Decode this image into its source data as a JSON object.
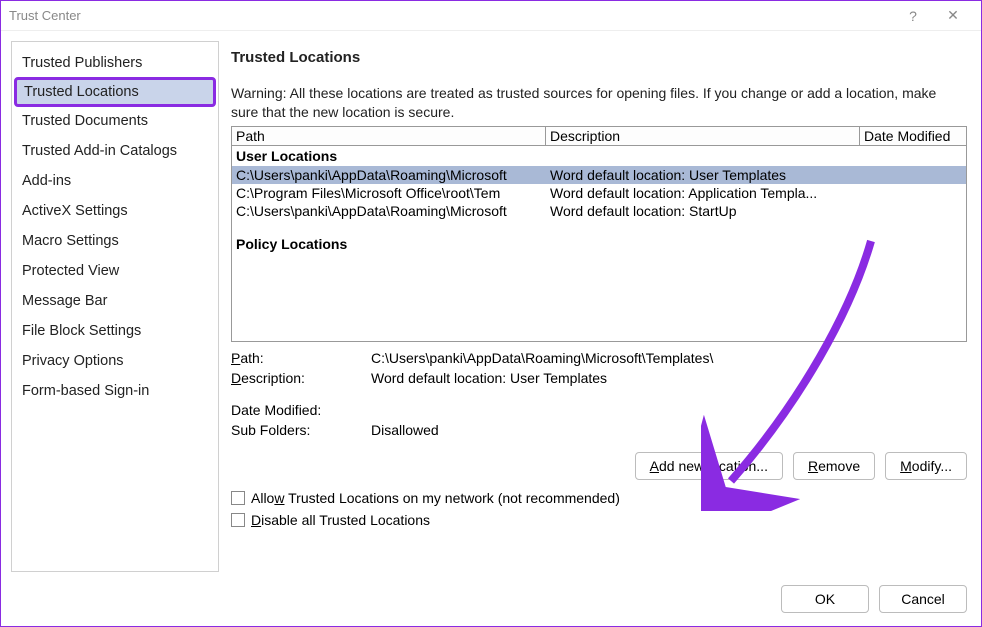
{
  "window": {
    "title": "Trust Center",
    "help_tooltip": "?",
    "close_tooltip": "✕"
  },
  "sidebar": {
    "items": [
      {
        "label": "Trusted Publishers",
        "selected": false
      },
      {
        "label": "Trusted Locations",
        "selected": true
      },
      {
        "label": "Trusted Documents",
        "selected": false
      },
      {
        "label": "Trusted Add-in Catalogs",
        "selected": false
      },
      {
        "label": "Add-ins",
        "selected": false
      },
      {
        "label": "ActiveX Settings",
        "selected": false
      },
      {
        "label": "Macro Settings",
        "selected": false
      },
      {
        "label": "Protected View",
        "selected": false
      },
      {
        "label": "Message Bar",
        "selected": false
      },
      {
        "label": "File Block Settings",
        "selected": false
      },
      {
        "label": "Privacy Options",
        "selected": false
      },
      {
        "label": "Form-based Sign-in",
        "selected": false
      }
    ]
  },
  "main": {
    "heading": "Trusted Locations",
    "warning": "Warning: All these locations are treated as trusted sources for opening files.  If you change or add a location, make sure that the new location is secure.",
    "columns": {
      "path": "Path",
      "desc": "Description",
      "date": "Date Modified"
    },
    "groups": {
      "user": "User Locations",
      "policy": "Policy Locations"
    },
    "rows": [
      {
        "path": "C:\\Users\\panki\\AppData\\Roaming\\Microsoft",
        "desc": "Word default location: User Templates",
        "date": "",
        "selected": true
      },
      {
        "path": "C:\\Program Files\\Microsoft Office\\root\\Tem",
        "desc": "Word default location: Application Templa...",
        "date": "",
        "selected": false
      },
      {
        "path": "C:\\Users\\panki\\AppData\\Roaming\\Microsoft",
        "desc": "Word default location: StartUp",
        "date": "",
        "selected": false
      }
    ],
    "details": {
      "path_label": "Path:",
      "path_value": "C:\\Users\\panki\\AppData\\Roaming\\Microsoft\\Templates\\",
      "desc_label": "Description:",
      "desc_value": "Word default location: User Templates",
      "date_label": "Date Modified:",
      "date_value": "",
      "sub_label": "Sub Folders:",
      "sub_value": "Disallowed"
    },
    "buttons": {
      "add": "Add new location...",
      "remove": "Remove",
      "modify": "Modify..."
    },
    "checks": {
      "allow_net": "Allow Trusted Locations on my network (not recommended)",
      "disable_all": "Disable all Trusted Locations"
    }
  },
  "footer": {
    "ok": "OK",
    "cancel": "Cancel"
  }
}
